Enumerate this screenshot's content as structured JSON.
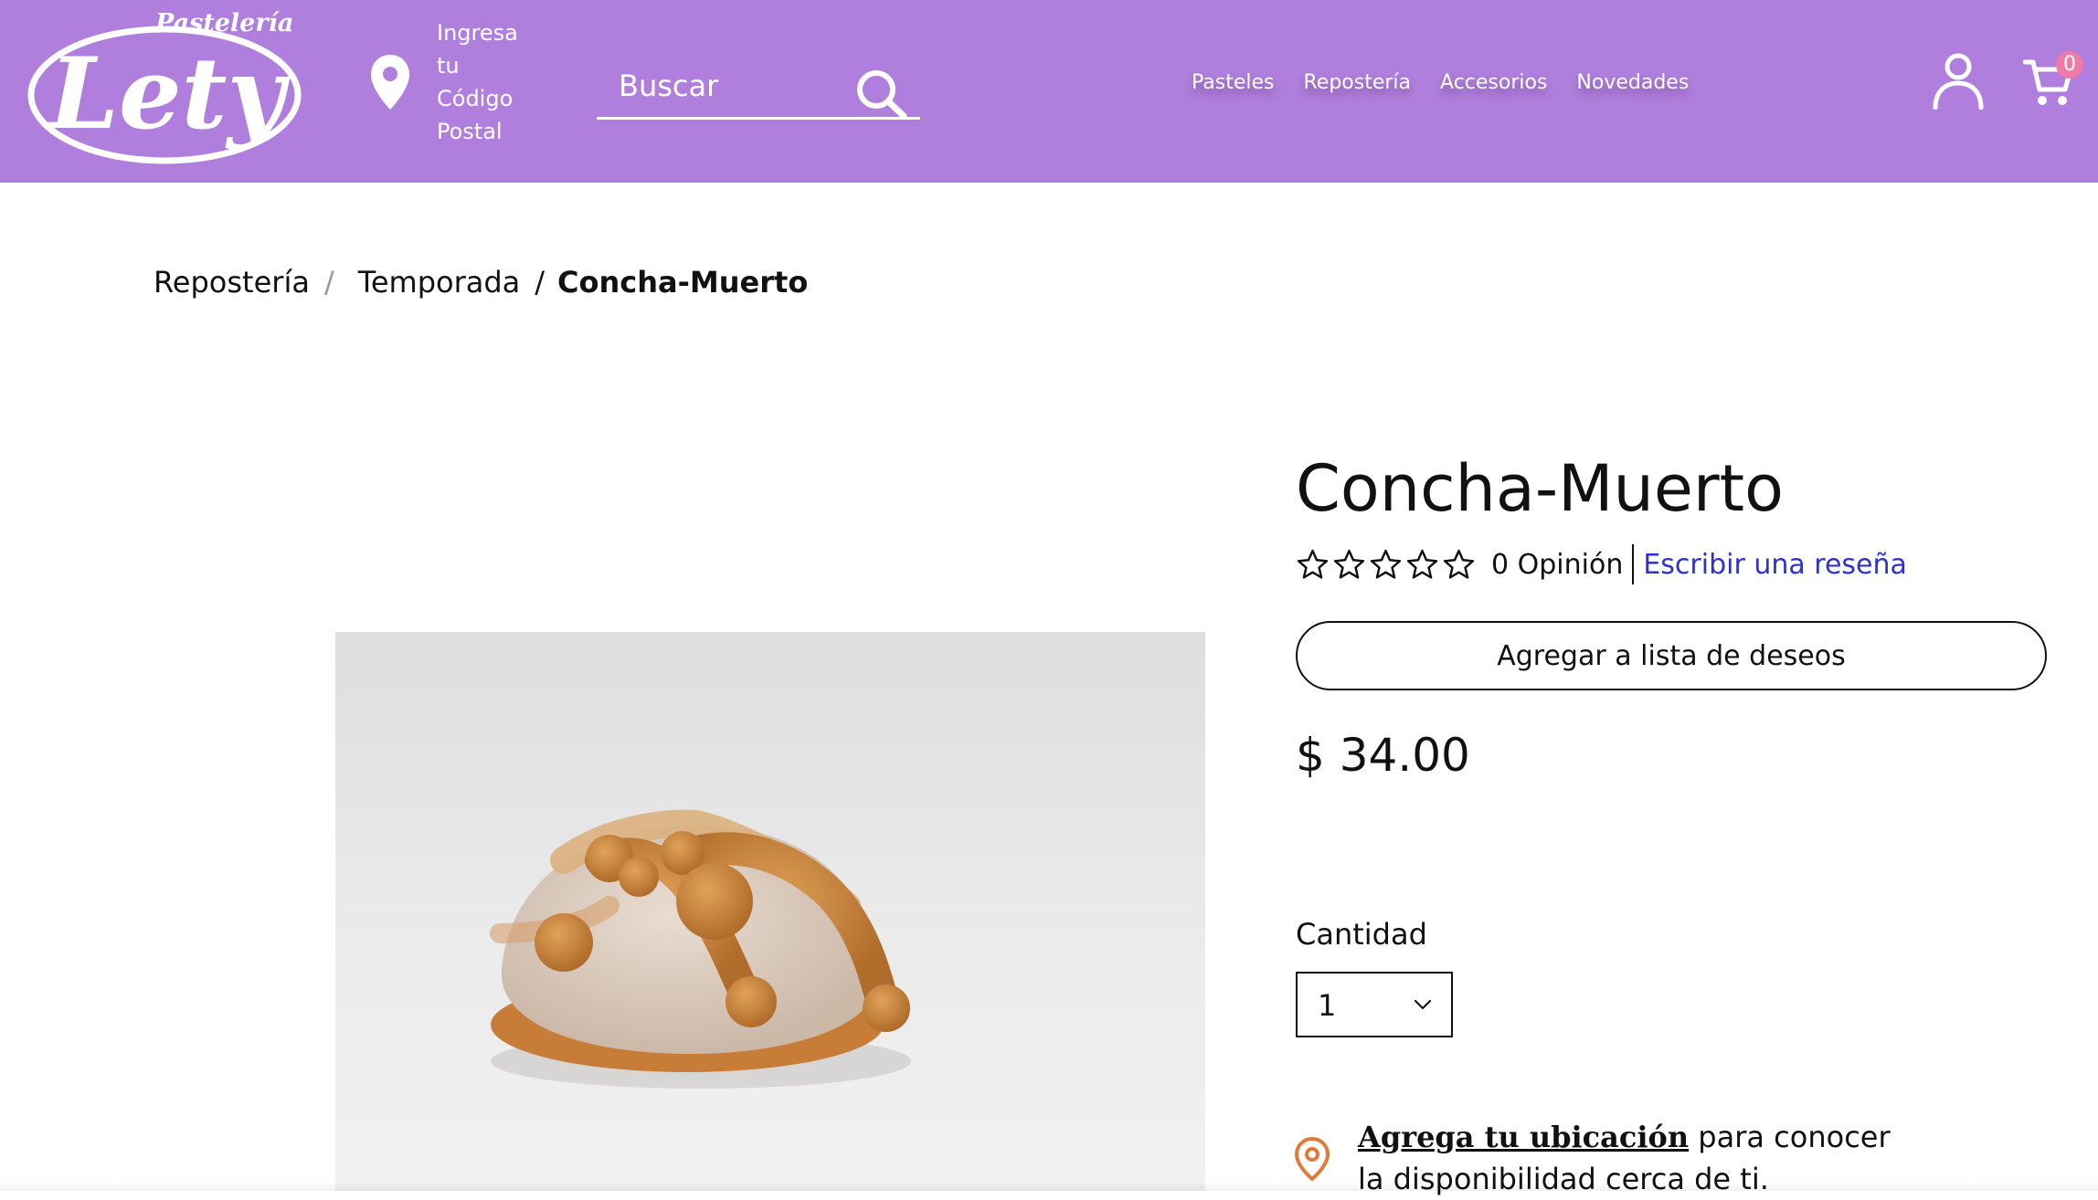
{
  "header": {
    "logo_top": "Pastelería",
    "logo_main": "Lety",
    "location_prompt": [
      "Ingresa",
      "tu",
      "Código",
      "Postal"
    ],
    "search_placeholder": "Buscar",
    "nav": [
      "Pasteles",
      "Repostería",
      "Accesorios",
      "Novedades"
    ],
    "cart_count": "0",
    "icons": [
      "location-pin-icon",
      "search-icon",
      "user-icon",
      "cart-icon"
    ],
    "background_color": "#b07fdd"
  },
  "breadcrumb": {
    "items": [
      "Repostería",
      "Temporada"
    ],
    "separator": "/",
    "current": "Concha-Muerto"
  },
  "product": {
    "title": "Concha-Muerto",
    "rating_stars": 0,
    "rating_max": 5,
    "opinion_count": "0 Opinión",
    "review_link": "Escribir una reseña",
    "wishlist_label": "Agregar a lista de deseos",
    "price": "$ 34.00",
    "quantity_label": "Cantidad",
    "quantity_value": "1",
    "availability_link": "Agrega tu ubicación",
    "availability_text": " para conocer la disponibilidad cerca de ti."
  },
  "colors": {
    "accent": "#b07fdd",
    "link": "#2e33cc",
    "pin": "#e07b3c",
    "badge": "#f07aa8"
  }
}
